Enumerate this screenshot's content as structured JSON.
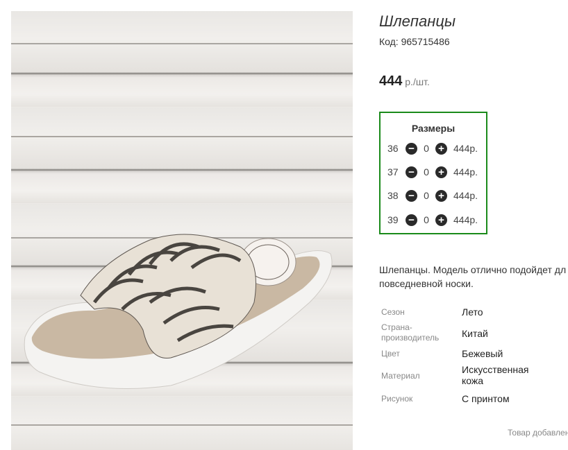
{
  "product": {
    "title": "Шлепанцы",
    "code_label": "Код: 965715486",
    "price_amount": "444",
    "price_unit": " р./шт."
  },
  "sizes": {
    "title": "Размеры",
    "rows": [
      {
        "size": "36",
        "qty": "0",
        "price": "444р."
      },
      {
        "size": "37",
        "qty": "0",
        "price": "444р."
      },
      {
        "size": "38",
        "qty": "0",
        "price": "444р."
      },
      {
        "size": "39",
        "qty": "0",
        "price": "444р."
      }
    ],
    "minus_icon": "minus-circle-icon",
    "plus_icon": "plus-circle-icon"
  },
  "description": {
    "line1": "Шлепанцы. Модель отлично подойдет дл",
    "line2": "повседневной носки."
  },
  "properties": [
    {
      "label": "Сезон",
      "value": "Лето"
    },
    {
      "label": "Страна-производитель",
      "value": "Китай"
    },
    {
      "label": "Цвет",
      "value": "Бежевый"
    },
    {
      "label": "Материал",
      "value": "Искусственная кожа"
    },
    {
      "label": "Рисунок",
      "value": "С принтом"
    }
  ],
  "footer": {
    "text": "Товар добавлен"
  },
  "colors": {
    "sizes_border": "#1a8a1a"
  }
}
